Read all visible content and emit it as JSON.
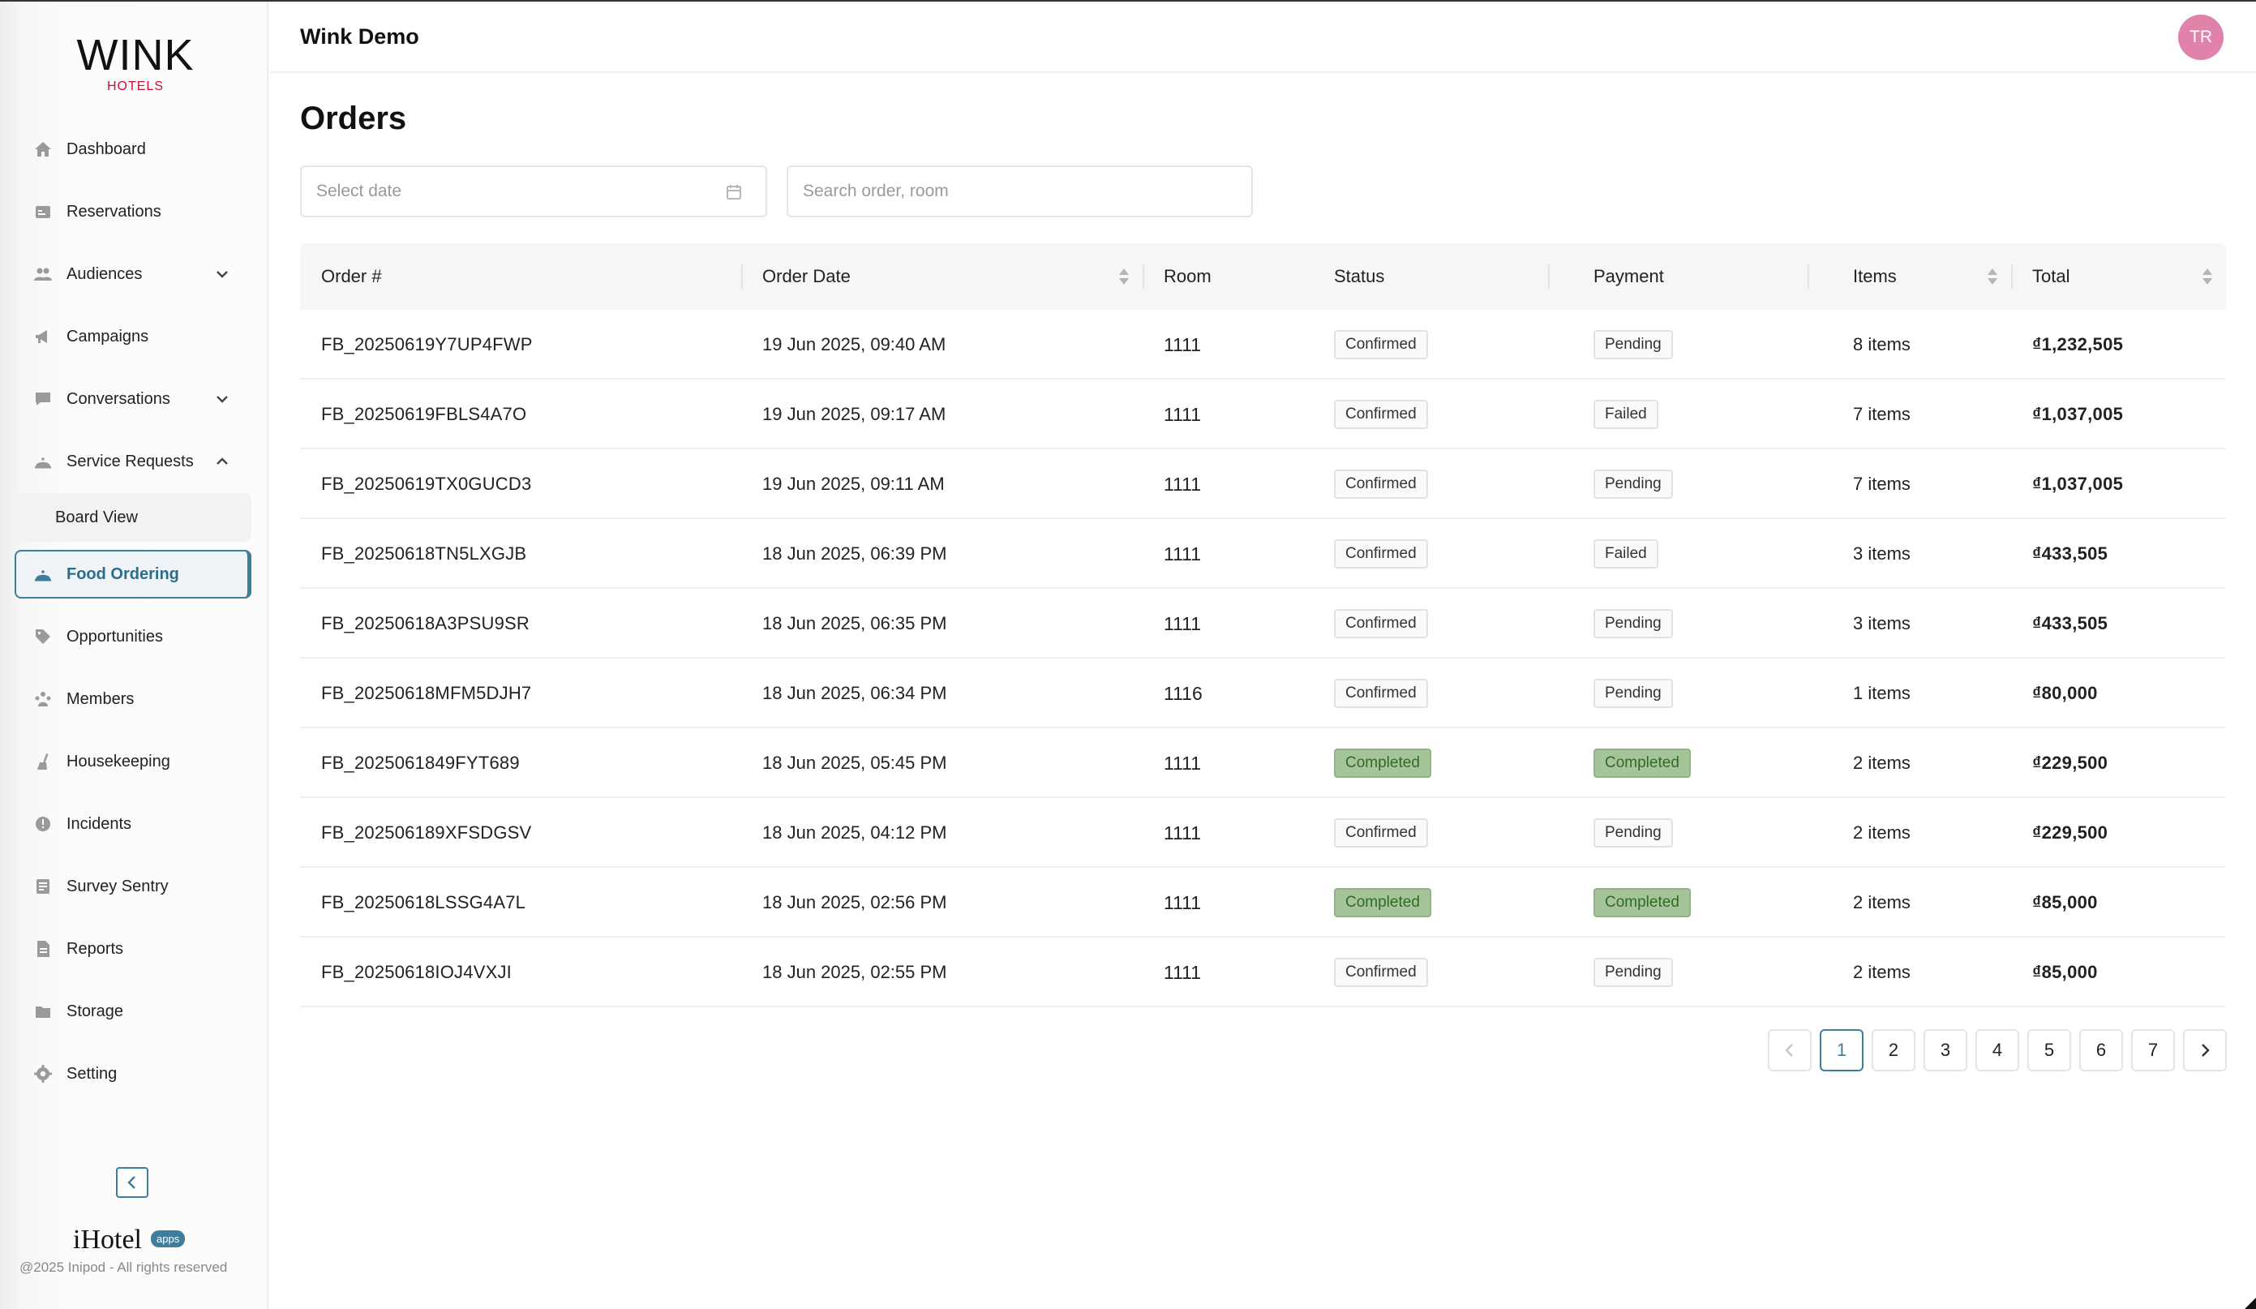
{
  "app": {
    "title": "Wink Demo",
    "logo_main": "WINK",
    "logo_sub": "HOTELS",
    "avatar_initials": "TR",
    "brand_footer": "iHotel",
    "brand_badge": "apps",
    "copyright": "@2025 Inipod - All rights reserved"
  },
  "sidebar": {
    "items": [
      {
        "label": "Dashboard",
        "icon": "home-icon"
      },
      {
        "label": "Reservations",
        "icon": "calendar-list-icon"
      },
      {
        "label": "Audiences",
        "icon": "users-icon",
        "chevron": "down"
      },
      {
        "label": "Campaigns",
        "icon": "megaphone-icon"
      },
      {
        "label": "Conversations",
        "icon": "chat-icon",
        "chevron": "down"
      },
      {
        "label": "Service Requests",
        "icon": "bell-service-icon",
        "chevron": "up"
      },
      {
        "label": "Board View",
        "sub": true
      },
      {
        "label": "Food Ordering",
        "icon": "bell-service-icon",
        "active": true
      },
      {
        "label": "Opportunities",
        "icon": "tag-icon"
      },
      {
        "label": "Members",
        "icon": "members-icon"
      },
      {
        "label": "Housekeeping",
        "icon": "broom-icon"
      },
      {
        "label": "Incidents",
        "icon": "alert-icon"
      },
      {
        "label": "Survey Sentry",
        "icon": "survey-icon"
      },
      {
        "label": "Reports",
        "icon": "report-icon"
      },
      {
        "label": "Storage",
        "icon": "storage-icon"
      },
      {
        "label": "Setting",
        "icon": "gear-icon"
      }
    ]
  },
  "page": {
    "title": "Orders",
    "date_placeholder": "Select date",
    "search_placeholder": "Search order, room"
  },
  "table": {
    "columns": [
      "Order #",
      "Order Date",
      "Room",
      "Status",
      "Payment",
      "Items",
      "Total"
    ],
    "rows": [
      {
        "order": "FB_20250619Y7UP4FWP",
        "date": "19 Jun 2025, 09:40 AM",
        "room": "1111",
        "status": "Confirmed",
        "payment": "Pending",
        "items": "8 items",
        "total": "₫1,232,505"
      },
      {
        "order": "FB_20250619FBLS4A7O",
        "date": "19 Jun 2025, 09:17 AM",
        "room": "1111",
        "status": "Confirmed",
        "payment": "Failed",
        "items": "7 items",
        "total": "₫1,037,005"
      },
      {
        "order": "FB_20250619TX0GUCD3",
        "date": "19 Jun 2025, 09:11 AM",
        "room": "1111",
        "status": "Confirmed",
        "payment": "Pending",
        "items": "7 items",
        "total": "₫1,037,005"
      },
      {
        "order": "FB_20250618TN5LXGJB",
        "date": "18 Jun 2025, 06:39 PM",
        "room": "1111",
        "status": "Confirmed",
        "payment": "Failed",
        "items": "3 items",
        "total": "₫433,505"
      },
      {
        "order": "FB_20250618A3PSU9SR",
        "date": "18 Jun 2025, 06:35 PM",
        "room": "1111",
        "status": "Confirmed",
        "payment": "Pending",
        "items": "3 items",
        "total": "₫433,505"
      },
      {
        "order": "FB_20250618MFM5DJH7",
        "date": "18 Jun 2025, 06:34 PM",
        "room": "1116",
        "status": "Confirmed",
        "payment": "Pending",
        "items": "1 items",
        "total": "₫80,000"
      },
      {
        "order": "FB_2025061849FYT689",
        "date": "18 Jun 2025, 05:45 PM",
        "room": "1111",
        "status": "Completed",
        "payment": "Completed",
        "items": "2 items",
        "total": "₫229,500"
      },
      {
        "order": "FB_202506189XFSDGSV",
        "date": "18 Jun 2025, 04:12 PM",
        "room": "1111",
        "status": "Confirmed",
        "payment": "Pending",
        "items": "2 items",
        "total": "₫229,500"
      },
      {
        "order": "FB_20250618LSSG4A7L",
        "date": "18 Jun 2025, 02:56 PM",
        "room": "1111",
        "status": "Completed",
        "payment": "Completed",
        "items": "2 items",
        "total": "₫85,000"
      },
      {
        "order": "FB_20250618IOJ4VXJI",
        "date": "18 Jun 2025, 02:55 PM",
        "room": "1111",
        "status": "Confirmed",
        "payment": "Pending",
        "items": "2 items",
        "total": "₫85,000"
      }
    ]
  },
  "pagination": {
    "pages": [
      "1",
      "2",
      "3",
      "4",
      "5",
      "6",
      "7"
    ],
    "current": "1"
  },
  "colors": {
    "accent": "#3e7e9c",
    "completed_bg": "#a6c49a",
    "avatar": "#e082aa",
    "logo_sub": "#c8102e"
  }
}
